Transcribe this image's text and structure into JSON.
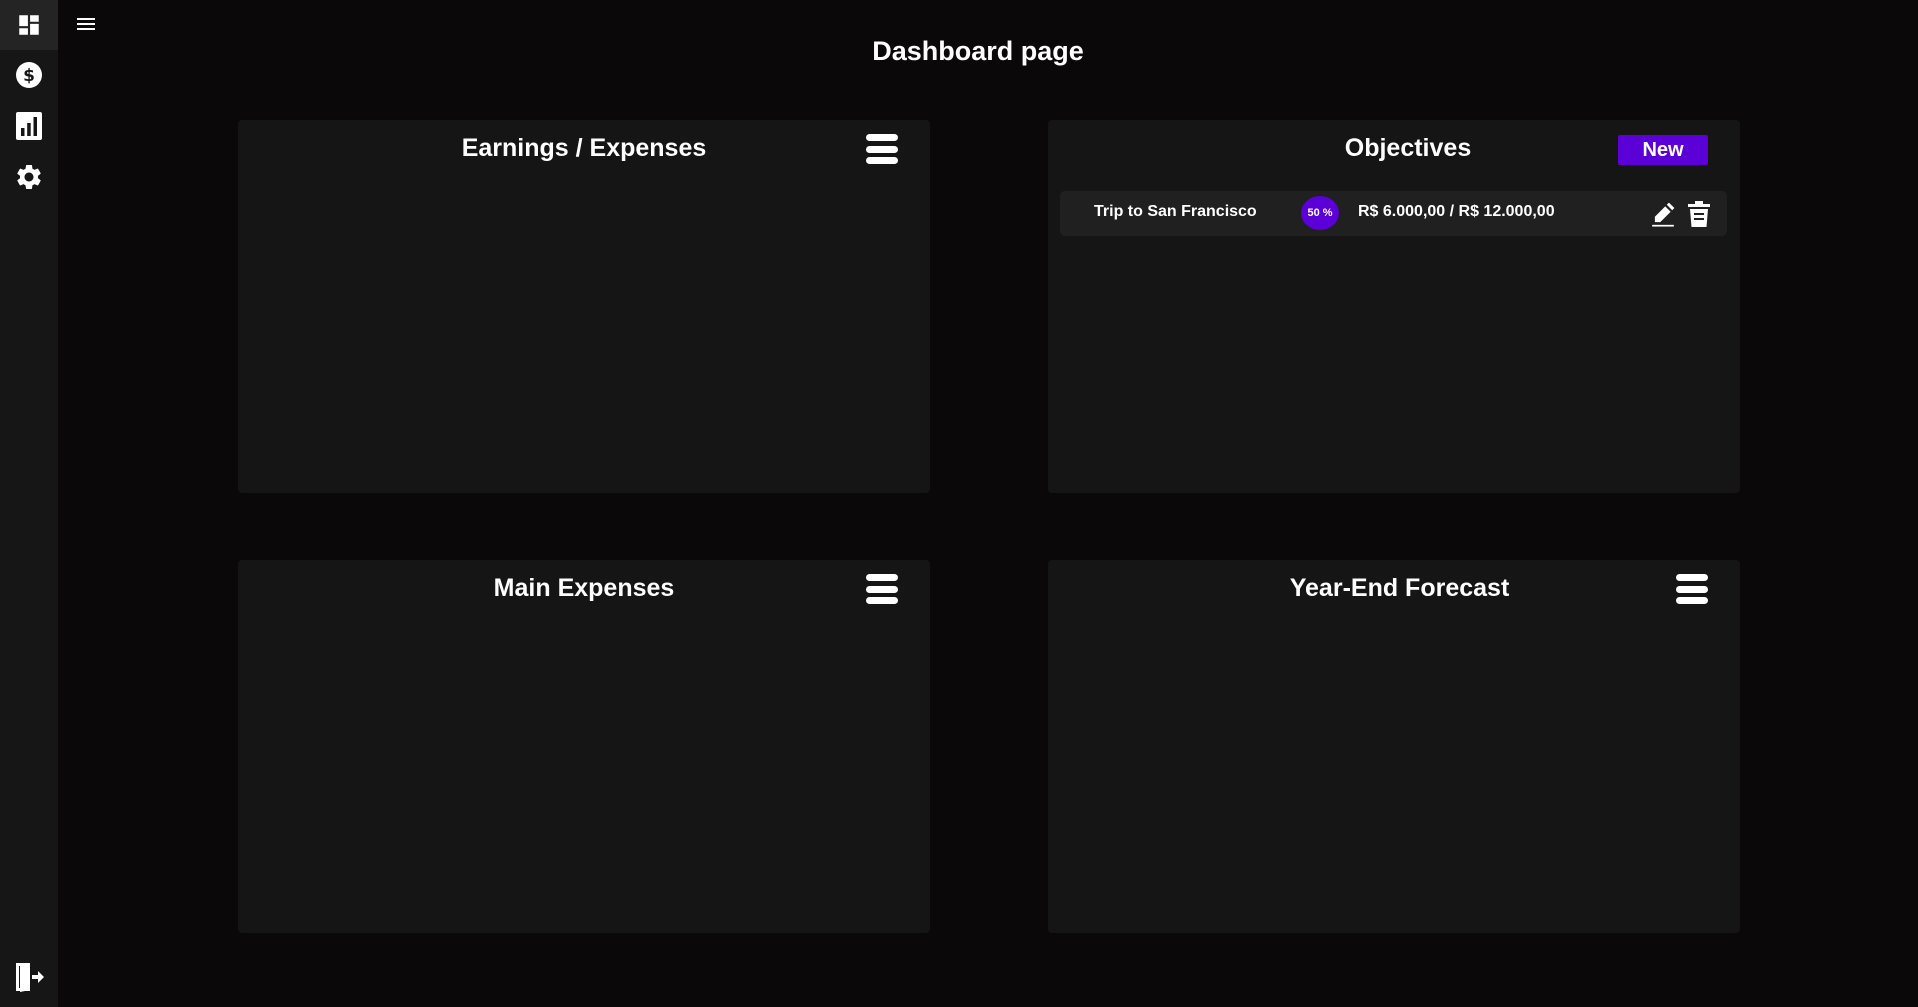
{
  "page": {
    "title": "Dashboard page"
  },
  "sidebar": {
    "items": [
      {
        "name": "dashboard",
        "icon": "dashboard-icon",
        "active": true
      },
      {
        "name": "finances",
        "icon": "dollar-circle-icon",
        "active": false
      },
      {
        "name": "reports",
        "icon": "bar-chart-icon",
        "active": false
      },
      {
        "name": "settings",
        "icon": "gear-icon",
        "active": false
      }
    ],
    "logout_icon": "logout-door-icon"
  },
  "cards": {
    "earnings": {
      "title": "Earnings / Expenses"
    },
    "objectives": {
      "title": "Objectives",
      "new_label": "New",
      "items": [
        {
          "name": "Trip to San Francisco",
          "percent": "50 %",
          "progress": 0.5,
          "amount": "R$ 6.000,00 / R$ 12.000,00"
        }
      ]
    },
    "main_expenses": {
      "title": "Main Expenses"
    },
    "forecast": {
      "title": "Year-End Forecast"
    }
  },
  "colors": {
    "background": "#0a0808",
    "sidebar": "#161616",
    "card": "#151515",
    "row": "#202020",
    "accent": "#5b00d6",
    "text": "#ffffff"
  }
}
